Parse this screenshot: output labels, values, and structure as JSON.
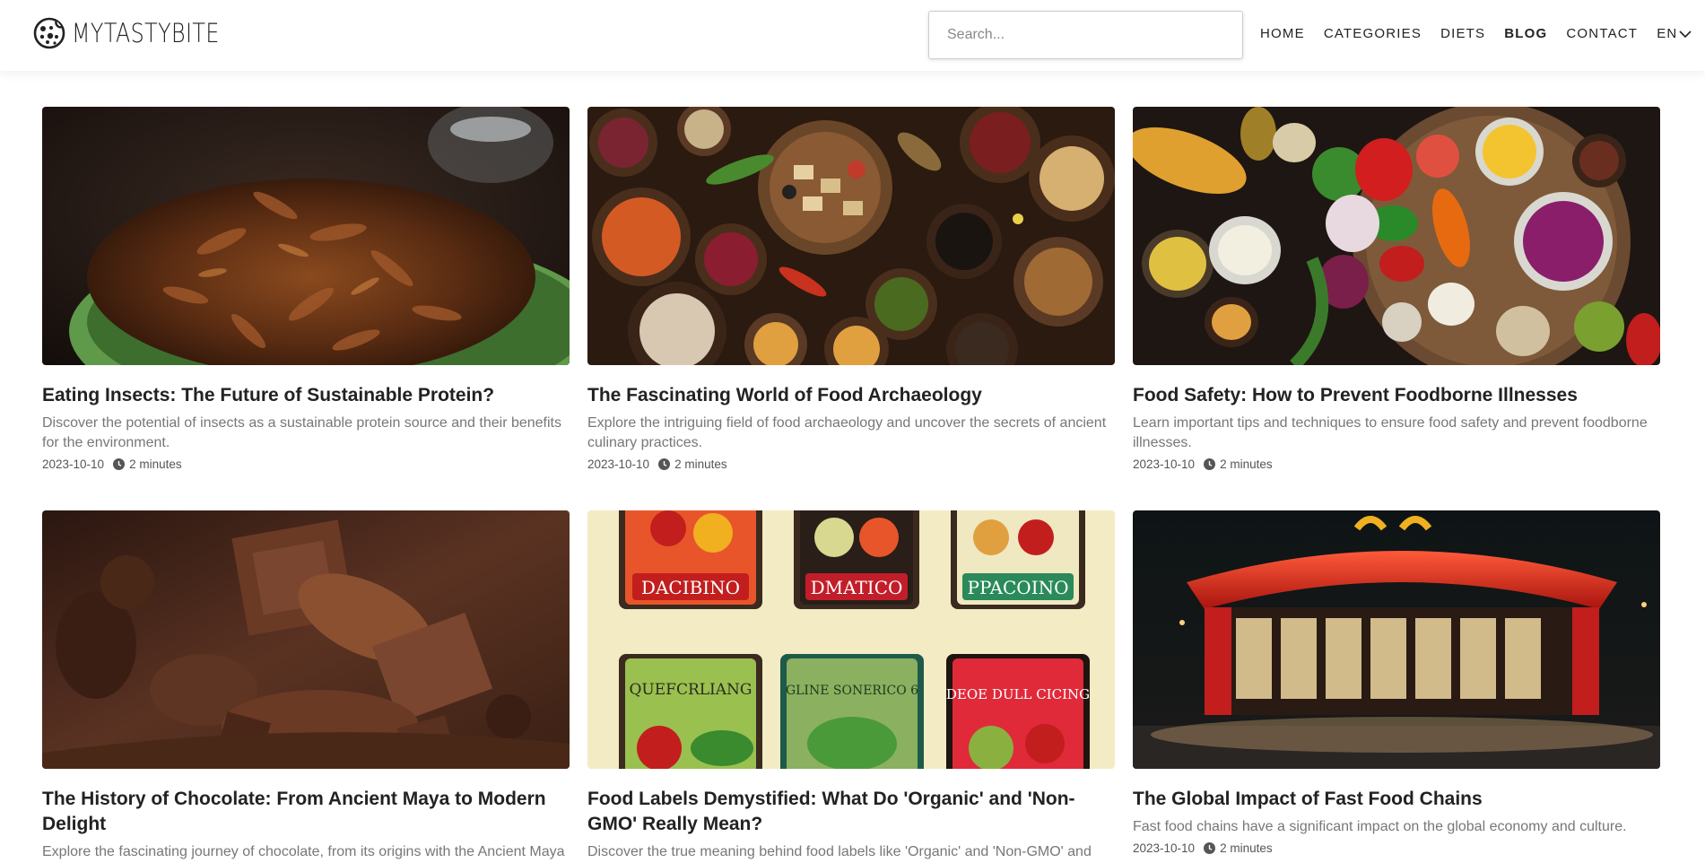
{
  "brand": {
    "name": "MYTASTYBITE"
  },
  "search": {
    "placeholder": "Search..."
  },
  "nav": {
    "items": [
      "HOME",
      "CATEGORIES",
      "DIETS",
      "BLOG",
      "CONTACT"
    ],
    "active": "BLOG",
    "language": "EN"
  },
  "icons": {
    "logo": "cookie-icon",
    "clock": "clock-icon",
    "chevron": "chevron-down-icon"
  },
  "posts": [
    {
      "title": "Eating Insects: The Future of Sustainable Protein?",
      "description": "Discover the potential of insects as a sustainable protein source and their benefits for the environment.",
      "date": "2023-10-10",
      "read_time": "2 minutes",
      "image": "roasted-insects-in-green-bowl"
    },
    {
      "title": "The Fascinating World of Food Archaeology",
      "description": "Explore the intriguing field of food archaeology and uncover the secrets of ancient culinary practices.",
      "date": "2023-10-10",
      "read_time": "2 minutes",
      "image": "bowls-of-spices-and-grains"
    },
    {
      "title": "Food Safety: How to Prevent Foodborne Illnesses",
      "description": "Learn important tips and techniques to ensure food safety and prevent foodborne illnesses.",
      "date": "2023-10-10",
      "read_time": "2 minutes",
      "image": "fresh-vegetables-on-table"
    },
    {
      "title": "The History of Chocolate: From Ancient Maya to Modern Delight",
      "description": "Explore the fascinating journey of chocolate, from its origins with the Ancient Maya",
      "date": "",
      "read_time": "",
      "image": "carved-chocolate-pieces"
    },
    {
      "title": "Food Labels Demystified: What Do 'Organic' and 'Non-GMO' Really Mean?",
      "description": "Discover the true meaning behind food labels like 'Organic' and 'Non-GMO' and",
      "date": "",
      "read_time": "",
      "image": "vintage-vegetable-labels",
      "label_texts": [
        "DACIBINO",
        "DMATICO",
        "PPACOINO",
        "QUEFCRLIANG",
        "GLINE SONERICO 6",
        "DEOE DULL CICING"
      ]
    },
    {
      "title": "The Global Impact of Fast Food Chains",
      "description": "Fast food chains have a significant impact on the global economy and culture.",
      "date": "2023-10-10",
      "read_time": "2 minutes",
      "image": "fast-food-restaurant-at-night"
    }
  ]
}
